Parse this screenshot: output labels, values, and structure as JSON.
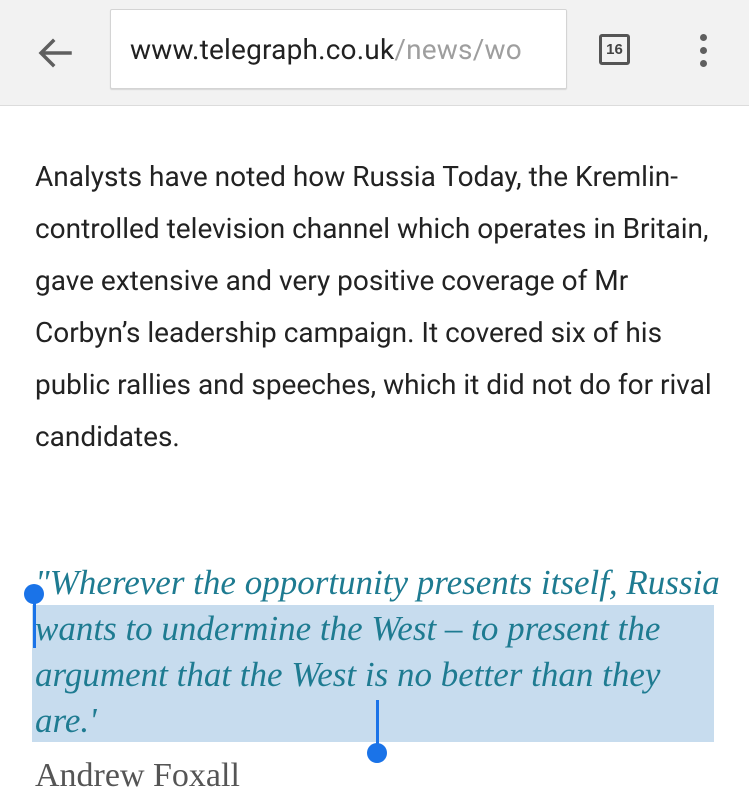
{
  "browser": {
    "url_host": "www.telegraph.co.uk",
    "url_path": "/news/wo",
    "tab_count": "16"
  },
  "article": {
    "paragraph": "Analysts have noted how Russia Today, the Kremlin-controlled television channel which operates in Britain, gave extensive and very positive coverage of Mr Corbyn’s leadership campaign. It covered six of his public rallies and speeches, which it did not do for rival candidates.",
    "quote": "\"Wherever the opportunity presents itself, Russia wants to undermine the West – to present the argument that the West is no better than they are.'",
    "author": "Andrew Foxall"
  }
}
